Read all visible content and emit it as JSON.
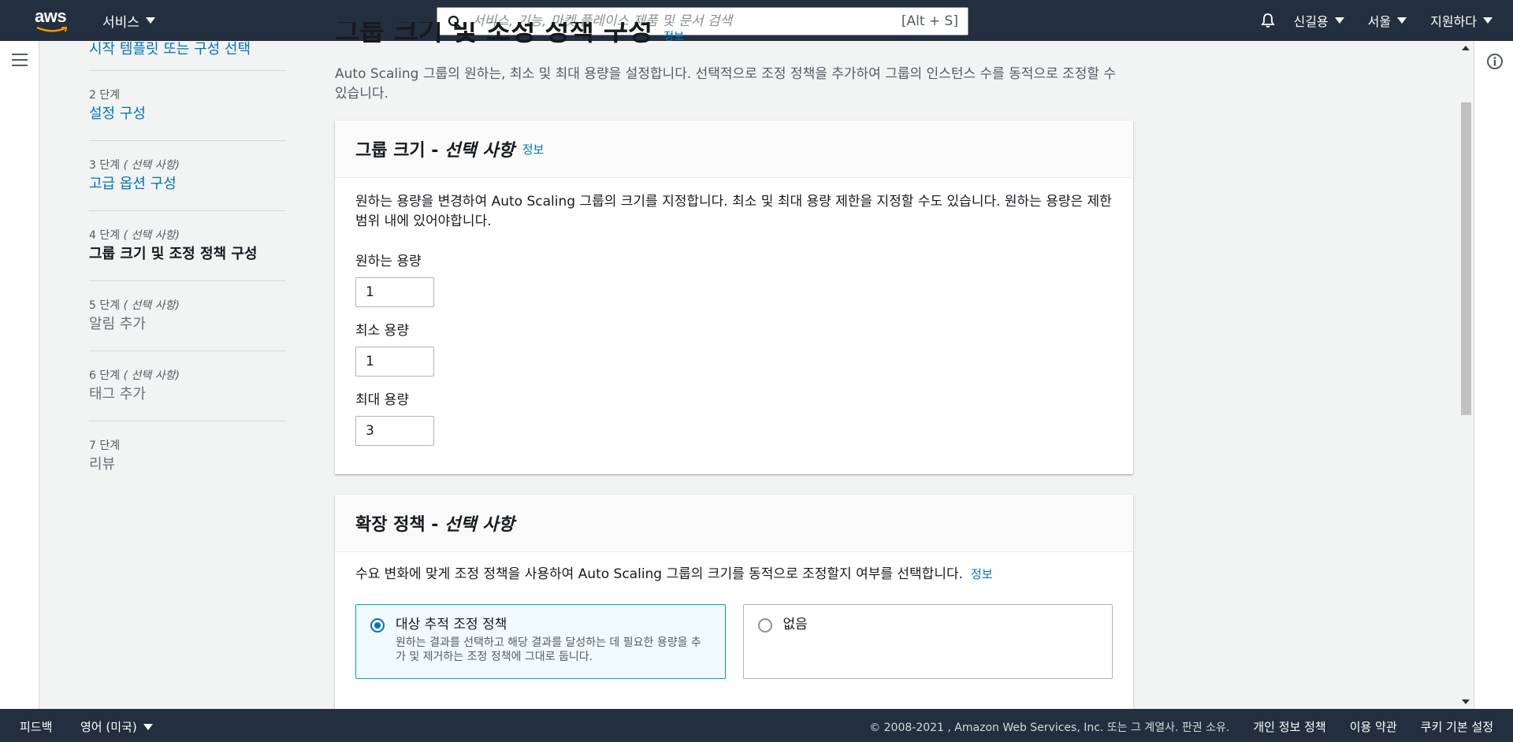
{
  "topnav": {
    "logo_text": "aws",
    "services_label": "서비스",
    "search_placeholder": "서비스, 기능, 마켓 플레이스 제품 및 문서 검색",
    "search_shortcut": "[Alt + S]",
    "user_label": "신길용",
    "region_label": "서울",
    "support_label": "지원하다"
  },
  "steps": [
    {
      "title": "시작 템플릿 또는 구성 선택",
      "state": "link"
    },
    {
      "num": "2 단계",
      "optional": "",
      "title": "설정 구성",
      "state": "link"
    },
    {
      "num": "3 단계",
      "optional": "( 선택 사항)",
      "title": "고급 옵션 구성",
      "state": "link"
    },
    {
      "num": "4 단계",
      "optional": "( 선택 사항)",
      "title": "그룹 크기 및 조정 정책 구성",
      "state": "current"
    },
    {
      "num": "5 단계",
      "optional": "( 선택 사항)",
      "title": "알림 추가",
      "state": "disabled"
    },
    {
      "num": "6 단계",
      "optional": "( 선택 사항)",
      "title": "태그 추가",
      "state": "disabled"
    },
    {
      "num": "7 단계",
      "optional": "",
      "title": "리뷰",
      "state": "disabled"
    }
  ],
  "main": {
    "page_title": "그룹 크기 및 조정 정책 구성",
    "page_title_info": "정보",
    "intro": "Auto Scaling 그룹의 원하는, 최소 및 최대 용량을 설정합니다. 선택적으로 조정 정책을 추가하여 그룹의 인스턴스 수를 동적으로 조정할 수 있습니다."
  },
  "group_size": {
    "title_prefix": "그룹 크기 - ",
    "title_optional": "선택 사항",
    "info": "정보",
    "description": "원하는 용량을 변경하여 Auto Scaling 그룹의 크기를 지정합니다. 최소 및 최대 용량 제한을 지정할 수도 있습니다. 원하는 용량은 제한 범위 내에 있어야합니다.",
    "desired_label": "원하는 용량",
    "desired_value": "1",
    "min_label": "최소 용량",
    "min_value": "1",
    "max_label": "최대 용량",
    "max_value": "3"
  },
  "scaling_policy": {
    "title_prefix": "확장 정책 - ",
    "title_optional": "선택 사항",
    "description": "수요 변화에 맞게 조정 정책을 사용하여 Auto Scaling 그룹의 크기를 동적으로 조정할지 여부를 선택합니다.",
    "info": "정보",
    "options": [
      {
        "title": "대상 추적 조정 정책",
        "desc": "원하는 결과를 선택하고 해당 결과를 달성하는 데 필요한 용량을 추가 및 제거하는 조정 정책에 그대로 둡니다.",
        "selected": true
      },
      {
        "title": "없음",
        "desc": "",
        "selected": false
      }
    ]
  },
  "footer": {
    "feedback": "피드백",
    "language": "영어 (미국)",
    "copyright": "© 2008-2021 , Amazon Web Services, Inc. 또는 그 계열사. 판권 소유.",
    "privacy": "개인 정보 정책",
    "terms": "이용 약관",
    "cookies": "쿠키 기본 설정"
  },
  "colors": {
    "nav_bg": "#232f3e",
    "link": "#0073bb",
    "selected_border": "#00a1c9",
    "aws_orange": "#ff9900"
  }
}
